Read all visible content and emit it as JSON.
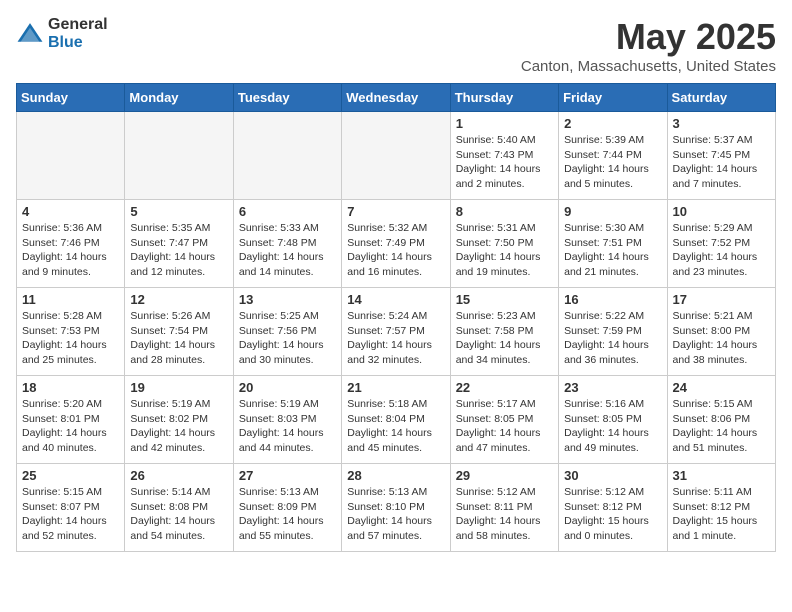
{
  "header": {
    "logo_general": "General",
    "logo_blue": "Blue",
    "title": "May 2025",
    "subtitle": "Canton, Massachusetts, United States"
  },
  "days_of_week": [
    "Sunday",
    "Monday",
    "Tuesday",
    "Wednesday",
    "Thursday",
    "Friday",
    "Saturday"
  ],
  "weeks": [
    [
      {
        "day": "",
        "info": ""
      },
      {
        "day": "",
        "info": ""
      },
      {
        "day": "",
        "info": ""
      },
      {
        "day": "",
        "info": ""
      },
      {
        "day": "1",
        "info": "Sunrise: 5:40 AM\nSunset: 7:43 PM\nDaylight: 14 hours\nand 2 minutes."
      },
      {
        "day": "2",
        "info": "Sunrise: 5:39 AM\nSunset: 7:44 PM\nDaylight: 14 hours\nand 5 minutes."
      },
      {
        "day": "3",
        "info": "Sunrise: 5:37 AM\nSunset: 7:45 PM\nDaylight: 14 hours\nand 7 minutes."
      }
    ],
    [
      {
        "day": "4",
        "info": "Sunrise: 5:36 AM\nSunset: 7:46 PM\nDaylight: 14 hours\nand 9 minutes."
      },
      {
        "day": "5",
        "info": "Sunrise: 5:35 AM\nSunset: 7:47 PM\nDaylight: 14 hours\nand 12 minutes."
      },
      {
        "day": "6",
        "info": "Sunrise: 5:33 AM\nSunset: 7:48 PM\nDaylight: 14 hours\nand 14 minutes."
      },
      {
        "day": "7",
        "info": "Sunrise: 5:32 AM\nSunset: 7:49 PM\nDaylight: 14 hours\nand 16 minutes."
      },
      {
        "day": "8",
        "info": "Sunrise: 5:31 AM\nSunset: 7:50 PM\nDaylight: 14 hours\nand 19 minutes."
      },
      {
        "day": "9",
        "info": "Sunrise: 5:30 AM\nSunset: 7:51 PM\nDaylight: 14 hours\nand 21 minutes."
      },
      {
        "day": "10",
        "info": "Sunrise: 5:29 AM\nSunset: 7:52 PM\nDaylight: 14 hours\nand 23 minutes."
      }
    ],
    [
      {
        "day": "11",
        "info": "Sunrise: 5:28 AM\nSunset: 7:53 PM\nDaylight: 14 hours\nand 25 minutes."
      },
      {
        "day": "12",
        "info": "Sunrise: 5:26 AM\nSunset: 7:54 PM\nDaylight: 14 hours\nand 28 minutes."
      },
      {
        "day": "13",
        "info": "Sunrise: 5:25 AM\nSunset: 7:56 PM\nDaylight: 14 hours\nand 30 minutes."
      },
      {
        "day": "14",
        "info": "Sunrise: 5:24 AM\nSunset: 7:57 PM\nDaylight: 14 hours\nand 32 minutes."
      },
      {
        "day": "15",
        "info": "Sunrise: 5:23 AM\nSunset: 7:58 PM\nDaylight: 14 hours\nand 34 minutes."
      },
      {
        "day": "16",
        "info": "Sunrise: 5:22 AM\nSunset: 7:59 PM\nDaylight: 14 hours\nand 36 minutes."
      },
      {
        "day": "17",
        "info": "Sunrise: 5:21 AM\nSunset: 8:00 PM\nDaylight: 14 hours\nand 38 minutes."
      }
    ],
    [
      {
        "day": "18",
        "info": "Sunrise: 5:20 AM\nSunset: 8:01 PM\nDaylight: 14 hours\nand 40 minutes."
      },
      {
        "day": "19",
        "info": "Sunrise: 5:19 AM\nSunset: 8:02 PM\nDaylight: 14 hours\nand 42 minutes."
      },
      {
        "day": "20",
        "info": "Sunrise: 5:19 AM\nSunset: 8:03 PM\nDaylight: 14 hours\nand 44 minutes."
      },
      {
        "day": "21",
        "info": "Sunrise: 5:18 AM\nSunset: 8:04 PM\nDaylight: 14 hours\nand 45 minutes."
      },
      {
        "day": "22",
        "info": "Sunrise: 5:17 AM\nSunset: 8:05 PM\nDaylight: 14 hours\nand 47 minutes."
      },
      {
        "day": "23",
        "info": "Sunrise: 5:16 AM\nSunset: 8:05 PM\nDaylight: 14 hours\nand 49 minutes."
      },
      {
        "day": "24",
        "info": "Sunrise: 5:15 AM\nSunset: 8:06 PM\nDaylight: 14 hours\nand 51 minutes."
      }
    ],
    [
      {
        "day": "25",
        "info": "Sunrise: 5:15 AM\nSunset: 8:07 PM\nDaylight: 14 hours\nand 52 minutes."
      },
      {
        "day": "26",
        "info": "Sunrise: 5:14 AM\nSunset: 8:08 PM\nDaylight: 14 hours\nand 54 minutes."
      },
      {
        "day": "27",
        "info": "Sunrise: 5:13 AM\nSunset: 8:09 PM\nDaylight: 14 hours\nand 55 minutes."
      },
      {
        "day": "28",
        "info": "Sunrise: 5:13 AM\nSunset: 8:10 PM\nDaylight: 14 hours\nand 57 minutes."
      },
      {
        "day": "29",
        "info": "Sunrise: 5:12 AM\nSunset: 8:11 PM\nDaylight: 14 hours\nand 58 minutes."
      },
      {
        "day": "30",
        "info": "Sunrise: 5:12 AM\nSunset: 8:12 PM\nDaylight: 15 hours\nand 0 minutes."
      },
      {
        "day": "31",
        "info": "Sunrise: 5:11 AM\nSunset: 8:12 PM\nDaylight: 15 hours\nand 1 minute."
      }
    ]
  ]
}
